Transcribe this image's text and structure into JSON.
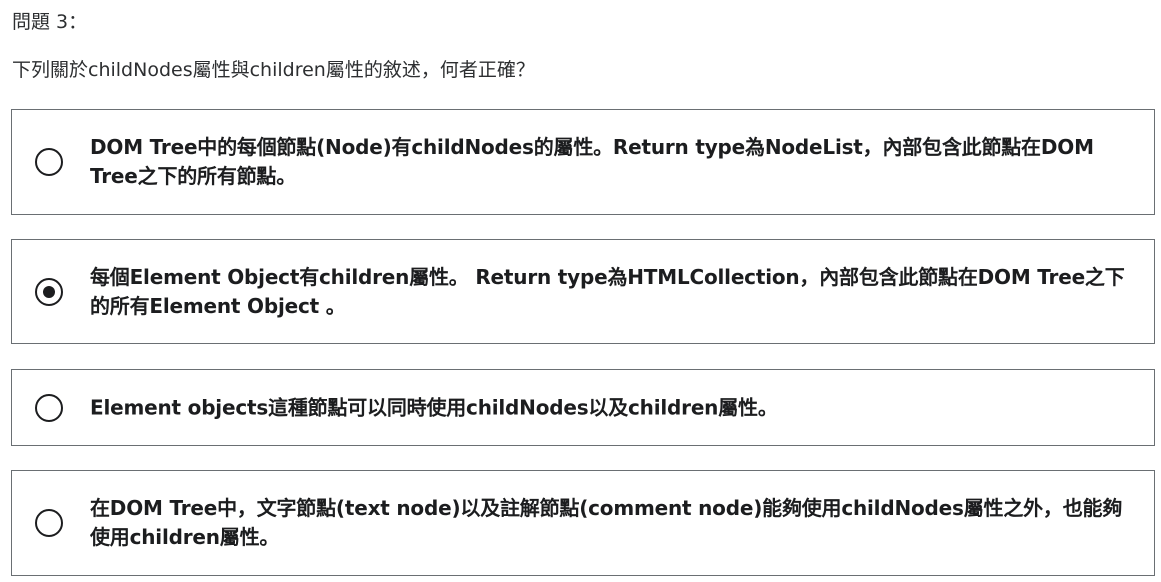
{
  "question": {
    "number_label": "問題 3：",
    "prompt": "下列關於childNodes屬性與children屬性的敘述，何者正確？"
  },
  "options": [
    {
      "text": "DOM Tree中的每個節點(Node)有childNodes的屬性。Return type為NodeList，內部包含此節點在DOM Tree之下的所有節點。",
      "selected": false
    },
    {
      "text": "每個Element Object有children屬性。 Return type為HTMLCollection，內部包含此節點在DOM Tree之下的所有Element Object 。",
      "selected": true
    },
    {
      "text": "Element objects這種節點可以同時使用childNodes以及children屬性。",
      "selected": false
    },
    {
      "text": "在DOM Tree中，文字節點(text node)以及註解節點(comment node)能夠使用childNodes屬性之外，也能夠使用children屬性。",
      "selected": false
    }
  ],
  "colors": {
    "text": "#1c1d1f",
    "border": "#6a6f73",
    "background": "#ffffff"
  }
}
